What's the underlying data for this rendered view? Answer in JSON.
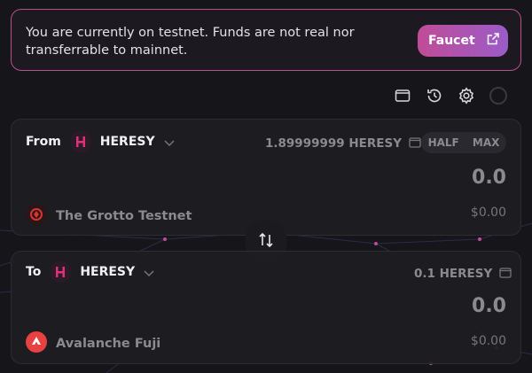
{
  "banner": {
    "message": "You are currently on testnet. Funds are not real nor transferrable to mainnet.",
    "faucet_label": "Faucet"
  },
  "toolbar": {
    "icons": [
      "wallet-icon",
      "history-icon",
      "settings-icon",
      "status-ring-icon"
    ]
  },
  "from": {
    "direction_label": "From",
    "token": "HERESY",
    "balance": "1.89999999 HERESY",
    "half_label": "HALF",
    "max_label": "MAX",
    "amount": "0.0",
    "network": "The Grotto Testnet",
    "usd_value": "$0.00"
  },
  "to": {
    "direction_label": "To",
    "token": "HERESY",
    "balance": "0.1 HERESY",
    "amount": "0.0",
    "network": "Avalanche Fuji",
    "usd_value": "$0.00"
  },
  "colors": {
    "accent_start": "#c04c97",
    "accent_end": "#9a5cc8",
    "banner_border": "#b94f8f",
    "background": "#16151a",
    "card": "#1e1d22",
    "muted_text": "#8c8a91"
  }
}
